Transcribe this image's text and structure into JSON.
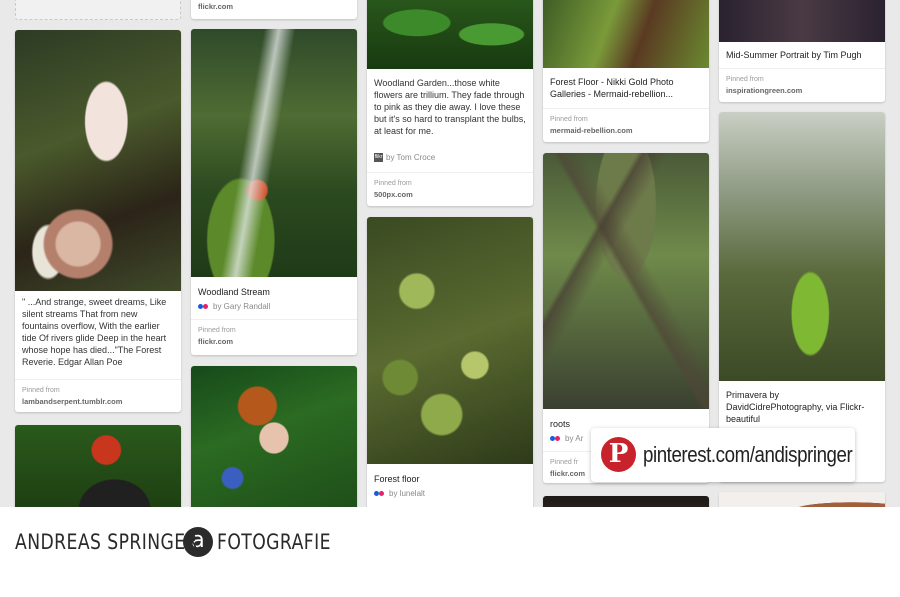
{
  "pins": {
    "col1_top": {
      "pinned_source": ""
    },
    "col2_top": {
      "pinned_source": "flickr.com"
    },
    "mushroom": {
      "description": "\" ...And strange, sweet dreams, Like silent streams That from new fountains overflow, With the earlier tide Of rivers glide Deep in the heart whose hope has died...\"The Forest Reverie. Edgar Allan Poe",
      "pinned_label": "Pinned from",
      "pinned_source": "lambandserpent.tumblr.com"
    },
    "woodland_stream": {
      "title": "Woodland Stream",
      "byline": "by Gary Randall",
      "pinned_label": "Pinned from",
      "pinned_source": "flickr.com"
    },
    "woodland_garden": {
      "description": "Woodland Garden...those white flowers are trillium. They fade through to pink as they die away. I love these but it's so hard to transplant the bulbs, at least for me.",
      "byline": "by Tom Croce",
      "avatar_text": "flikr",
      "pinned_label": "Pinned from",
      "pinned_source": "500px.com"
    },
    "forest_floor": {
      "title": "Forest floor",
      "byline": "by lunelalt"
    },
    "forest_floor_nikki": {
      "description": "Forest Floor - Nikki Gold Photo Galleries - Mermaid-rebellion...",
      "pinned_label": "Pinned from",
      "pinned_source": "mermaid-rebellion.com"
    },
    "roots": {
      "title": "roots",
      "byline": "by Ar",
      "pinned_label": "Pinned fr",
      "pinned_source": "flickr.com"
    },
    "midsummer": {
      "description": "Mid-Summer Portrait by Tim Pugh",
      "pinned_label": "Pinned from",
      "pinned_source": "inspirationgreen.com"
    },
    "primavera": {
      "description": "Primavera by DavidCidrePhotography, via Flickr- beautiful"
    }
  },
  "badge": {
    "logo_letter": "P",
    "url": "pinterest.com/andispringer"
  },
  "footer": {
    "name": "ANDREAS SPRINGER",
    "logo_letter": "a",
    "suffix": "FOTOGRAFIE"
  }
}
